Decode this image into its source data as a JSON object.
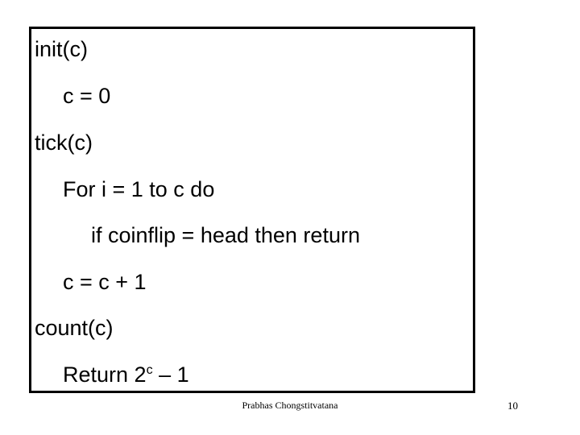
{
  "slide": {
    "background_color": "#ffffff",
    "text_color": "#000000",
    "border_color": "#000000",
    "code_box": {
      "lines": [
        {
          "text": "init(c)",
          "indent": 0
        },
        {
          "text": "c = 0",
          "indent": 1
        },
        {
          "text": "tick(c)",
          "indent": 0
        },
        {
          "text": "For i = 1 to c do",
          "indent": 1
        },
        {
          "text": "if coinflip = head then return",
          "indent": 2
        },
        {
          "text": "c = c + 1",
          "indent": 1
        },
        {
          "text": "count(c)",
          "indent": 0
        }
      ],
      "return_line": {
        "prefix": "Return 2",
        "superscript": "c",
        "suffix": " – 1",
        "indent": 1
      }
    }
  },
  "footer": {
    "author": "Prabhas Chongstitvatana",
    "page_number": "10"
  }
}
